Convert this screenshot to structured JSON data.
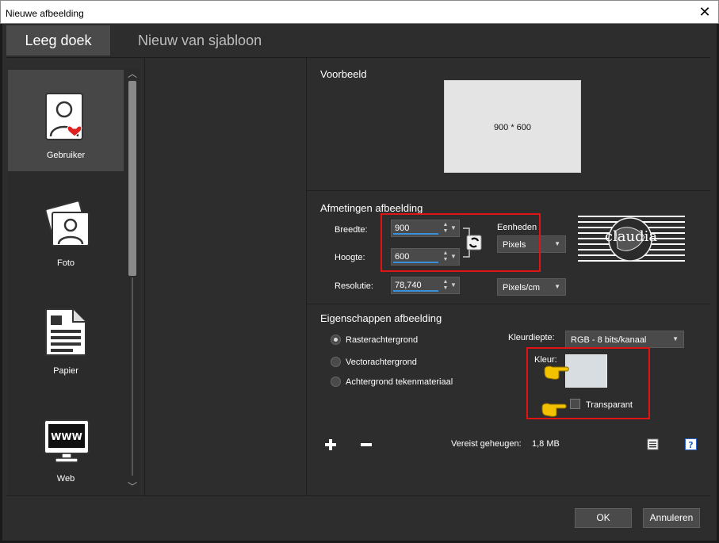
{
  "window": {
    "title": "Nieuwe afbeelding"
  },
  "tabs": [
    {
      "label": "Leeg doek",
      "active": true
    },
    {
      "label": "Nieuw van sjabloon",
      "active": false
    }
  ],
  "categories": [
    {
      "label": "Gebruiker",
      "icon": "user-heart-icon",
      "selected": true
    },
    {
      "label": "Foto",
      "icon": "photo-icon",
      "selected": false
    },
    {
      "label": "Papier",
      "icon": "paper-icon",
      "selected": false
    },
    {
      "label": "Web",
      "icon": "web-monitor-icon",
      "selected": false
    }
  ],
  "preview": {
    "title": "Voorbeeld",
    "text": "900 * 600"
  },
  "dimensions": {
    "title": "Afmetingen afbeelding",
    "width_label": "Breedte:",
    "width_value": "900",
    "height_label": "Hoogte:",
    "height_value": "600",
    "resolution_label": "Resolutie:",
    "resolution_value": "78,740",
    "units_label": "Eenheden",
    "units_value": "Pixels",
    "res_units_value": "Pixels/cm"
  },
  "properties": {
    "title": "Eigenschappen afbeelding",
    "options": [
      {
        "label": "Rasterachtergrond",
        "selected": true
      },
      {
        "label": "Vectorachtergrond",
        "selected": false
      },
      {
        "label": "Achtergrond tekenmateriaal",
        "selected": false
      }
    ],
    "depth_label": "Kleurdiepte:",
    "depth_value": "RGB - 8 bits/kanaal",
    "color_label": "Kleur:",
    "color_value": "#d8dde2",
    "transparent_label": "Transparant",
    "transparent_checked": false
  },
  "memory": {
    "label": "Vereist geheugen:",
    "value": "1,8 MB"
  },
  "watermark": {
    "text": "claudia"
  },
  "buttons": {
    "ok": "OK",
    "cancel": "Annuleren"
  },
  "colors": {
    "accent": "#3a8fd9",
    "highlight": "#e01414",
    "pointer": "#f2c200"
  }
}
